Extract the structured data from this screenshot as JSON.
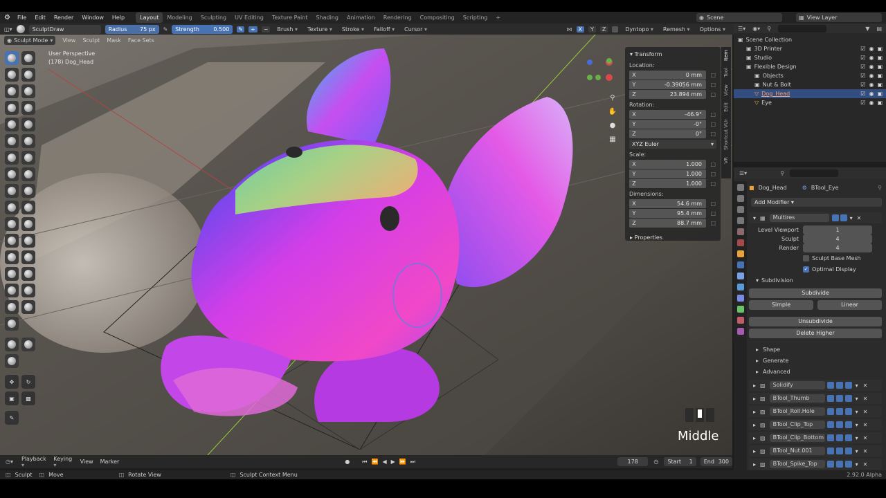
{
  "menu": [
    "File",
    "Edit",
    "Render",
    "Window",
    "Help"
  ],
  "workspaces": [
    "Layout",
    "Modeling",
    "Sculpting",
    "UV Editing",
    "Texture Paint",
    "Shading",
    "Animation",
    "Rendering",
    "Compositing",
    "Scripting"
  ],
  "active_workspace": "Layout",
  "scene_label": "Scene",
  "view_layer_label": "View Layer",
  "tool_header": {
    "brush_name": "SculptDraw",
    "radius_label": "Radius",
    "radius_value": "75 px",
    "strength_label": "Strength",
    "strength_value": "0.500",
    "brush": "Brush",
    "texture": "Texture",
    "stroke": "Stroke",
    "falloff": "Falloff",
    "cursor": "Cursor",
    "x": "X",
    "y": "Y",
    "z": "Z",
    "dyntopo": "Dyntopo",
    "remesh": "Remesh",
    "options": "Options"
  },
  "viewport_header": {
    "mode": "Sculpt Mode",
    "view": "View",
    "sculpt": "Sculpt",
    "mask": "Mask",
    "face_sets": "Face Sets"
  },
  "viewport_info": {
    "perspective": "User Perspective",
    "object": "(178) Dog_Head"
  },
  "overlay_text": "Middle",
  "transform": {
    "title": "Transform",
    "location_label": "Location:",
    "location": [
      {
        "axis": "X",
        "value": "0 mm"
      },
      {
        "axis": "Y",
        "value": "-0.39056 mm"
      },
      {
        "axis": "Z",
        "value": "23.894 mm"
      }
    ],
    "rotation_label": "Rotation:",
    "rotation": [
      {
        "axis": "X",
        "value": "-46.9°"
      },
      {
        "axis": "Y",
        "value": "-0°"
      },
      {
        "axis": "Z",
        "value": "0°"
      }
    ],
    "rotation_mode": "XYZ Euler",
    "scale_label": "Scale:",
    "scale": [
      {
        "axis": "X",
        "value": "1.000"
      },
      {
        "axis": "Y",
        "value": "1.000"
      },
      {
        "axis": "Z",
        "value": "1.000"
      }
    ],
    "dimensions_label": "Dimensions:",
    "dimensions": [
      {
        "axis": "X",
        "value": "54.6 mm"
      },
      {
        "axis": "Y",
        "value": "95.4 mm"
      },
      {
        "axis": "Z",
        "value": "88.7 mm"
      }
    ],
    "properties": "Properties"
  },
  "side_tabs": [
    "Item",
    "Tool",
    "View",
    "Edit",
    "Shortcut VUr",
    "VR"
  ],
  "outliner": {
    "items": [
      {
        "label": "Scene Collection",
        "indent": 0,
        "selected": false
      },
      {
        "label": "3D Printer",
        "indent": 1,
        "selected": false
      },
      {
        "label": "Studio",
        "indent": 1,
        "selected": false
      },
      {
        "label": "Flexible Design",
        "indent": 1,
        "selected": false
      },
      {
        "label": "Objects",
        "indent": 2,
        "selected": false
      },
      {
        "label": "Nut & Bolt",
        "indent": 2,
        "selected": false
      },
      {
        "label": "Dog_Head",
        "indent": 2,
        "selected": true
      },
      {
        "label": "Eye",
        "indent": 2,
        "selected": false
      }
    ]
  },
  "properties_panel": {
    "object_name": "Dog_Head",
    "modifier_target": "BTool_Eye",
    "add_modifier": "Add Modifier",
    "multires": {
      "name": "Multires",
      "level_viewport_label": "Level Viewport",
      "level_viewport": "1",
      "sculpt_label": "Sculpt",
      "sculpt": "4",
      "render_label": "Render",
      "render": "4",
      "sculpt_base_mesh": "Sculpt Base Mesh",
      "optimal_display": "Optimal Display",
      "subdivision": "Subdivision",
      "subdivide": "Subdivide",
      "simple": "Simple",
      "linear": "Linear",
      "unsubdivide": "Unsubdivide",
      "delete_higher": "Delete Higher",
      "shape": "Shape",
      "generate": "Generate",
      "advanced": "Advanced"
    },
    "modifiers": [
      "Solidify",
      "BTool_Thumb",
      "BTool_Roll.Hole",
      "BTool_Clip_Top",
      "BTool_Clip_Bottom",
      "BTool_Nut.001",
      "BTool_Spike_Top"
    ]
  },
  "timeline": {
    "playback": "Playback",
    "keying": "Keying",
    "view": "View",
    "marker": "Marker",
    "frame": "178",
    "start_label": "Start",
    "start": "1",
    "end_label": "End",
    "end": "300"
  },
  "status_bar": {
    "sculpt": "Sculpt",
    "move": "Move",
    "rotate_view": "Rotate View",
    "context_menu": "Sculpt Context Menu",
    "version": "2.92.0 Alpha"
  },
  "colors": {
    "accent": "#4772b3",
    "selection": "#334d80",
    "mesh_magenta": "#e040e8",
    "mesh_blue": "#3a4cf0",
    "mesh_green": "#8be07a"
  }
}
